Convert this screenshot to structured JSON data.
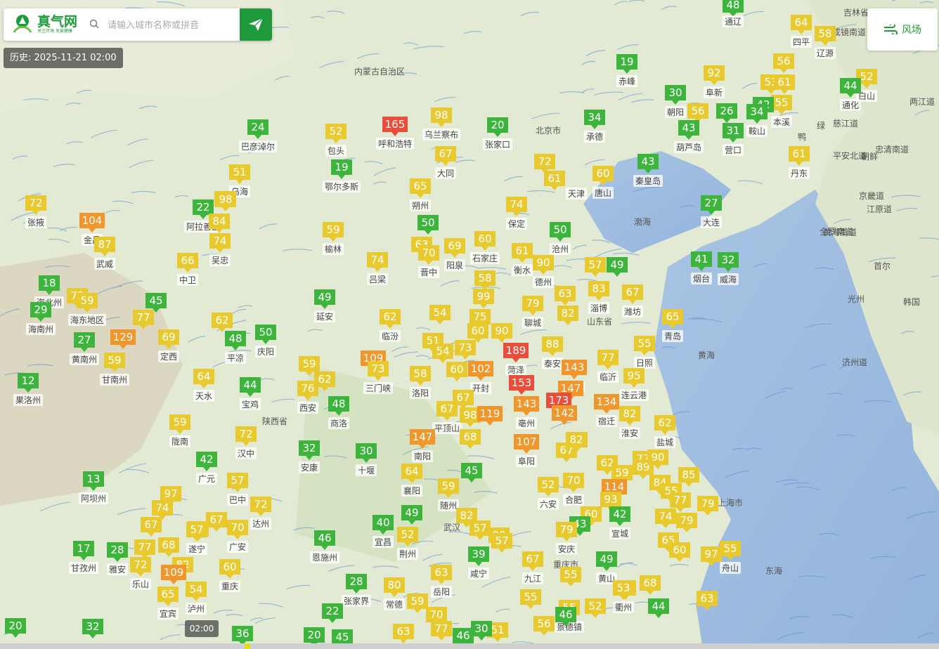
{
  "search": {
    "placeholder": "请输入城市名称或拼音"
  },
  "logo": {
    "title": "真气网",
    "slogan": "关注环境 关爱健康"
  },
  "history_label": "历史: 2025-11-21 02:00",
  "wind_button_label": "风场",
  "timeline_time": "02:00",
  "aqi_colors": {
    "good": "#3db53d",
    "moderate": "#e8c92e",
    "sensitive": "#f0962b",
    "unhealthy": "#e94e3c"
  },
  "places": [
    {
      "name": "",
      "aqi": 48
    },
    {
      "name": "通辽",
      "aqi": null
    },
    {
      "name": "四平",
      "aqi": 64
    },
    {
      "name": "辽源",
      "aqi": 58
    },
    {
      "name": "赤峰",
      "aqi": 19
    },
    {
      "name": "阜新",
      "aqi": 92
    },
    {
      "name": "",
      "aqi": 56
    },
    {
      "name": "",
      "aqi": 53
    },
    {
      "name": "",
      "aqi": 61
    },
    {
      "name": "本溪",
      "aqi": 55
    },
    {
      "name": "白山",
      "aqi": 52
    },
    {
      "name": "通化",
      "aqi": 44
    },
    {
      "name": "朝阳",
      "aqi": 30
    },
    {
      "name": "",
      "aqi": 56
    },
    {
      "name": "",
      "aqi": 26
    },
    {
      "name": "",
      "aqi": 42
    },
    {
      "name": "鞍山",
      "aqi": 34
    },
    {
      "name": "呼和浩特",
      "aqi": 165
    },
    {
      "name": "乌兰察布",
      "aqi": 98
    },
    {
      "name": "张家口",
      "aqi": 20
    },
    {
      "name": "承德",
      "aqi": 34
    },
    {
      "name": "葫芦岛",
      "aqi": 43
    },
    {
      "name": "营口",
      "aqi": 31
    },
    {
      "name": "巴彦淖尔",
      "aqi": 24
    },
    {
      "name": "包头",
      "aqi": 52
    },
    {
      "name": "鄂尔多斯",
      "aqi": 19
    },
    {
      "name": "大同",
      "aqi": 67
    },
    {
      "name": "",
      "aqi": 72
    },
    {
      "name": "",
      "aqi": 61
    },
    {
      "name": "唐山",
      "aqi": 60
    },
    {
      "name": "秦皇岛",
      "aqi": 43
    },
    {
      "name": "丹东",
      "aqi": 61
    },
    {
      "name": "乌海",
      "aqi": 51
    },
    {
      "name": "",
      "aqi": 64
    },
    {
      "name": "朔州",
      "aqi": 65
    },
    {
      "name": "天津",
      "aqi": null
    },
    {
      "name": "张掖",
      "aqi": 72
    },
    {
      "name": "阿拉善盟",
      "aqi": 22
    },
    {
      "name": "",
      "aqi": 98
    },
    {
      "name": "",
      "aqi": 84
    },
    {
      "name": "金昌",
      "aqi": 104
    },
    {
      "name": "武威",
      "aqi": 87
    },
    {
      "name": "保定",
      "aqi": 74
    },
    {
      "name": "大连",
      "aqi": 27
    },
    {
      "name": "榆林",
      "aqi": 59
    },
    {
      "name": "",
      "aqi": 50
    },
    {
      "name": "沧州",
      "aqi": 50
    },
    {
      "name": "吴忠",
      "aqi": 74
    },
    {
      "name": "中卫",
      "aqi": 66
    },
    {
      "name": "",
      "aqi": 63
    },
    {
      "name": "晋中",
      "aqi": 70
    },
    {
      "name": "阳泉",
      "aqi": 69
    },
    {
      "name": "石家庄",
      "aqi": 60
    },
    {
      "name": "衡水",
      "aqi": 61
    },
    {
      "name": "德州",
      "aqi": 90
    },
    {
      "name": "",
      "aqi": 57
    },
    {
      "name": "",
      "aqi": 49
    },
    {
      "name": "烟台",
      "aqi": 41
    },
    {
      "name": "威海",
      "aqi": 32
    },
    {
      "name": "吕梁",
      "aqi": 74
    },
    {
      "name": "",
      "aqi": 58
    },
    {
      "name": "",
      "aqi": 63
    },
    {
      "name": "淄博",
      "aqi": 83
    },
    {
      "name": "潍坊",
      "aqi": 67
    },
    {
      "name": "海北州",
      "aqi": 18
    },
    {
      "name": "",
      "aqi": 72
    },
    {
      "name": "海东地区",
      "aqi": 59
    },
    {
      "name": "",
      "aqi": 45
    },
    {
      "name": "延安",
      "aqi": 49
    },
    {
      "name": "",
      "aqi": 99
    },
    {
      "name": "聊城",
      "aqi": 79
    },
    {
      "name": "",
      "aqi": 82
    },
    {
      "name": "海南州",
      "aqi": 29
    },
    {
      "name": "",
      "aqi": 77
    },
    {
      "name": "",
      "aqi": 62
    },
    {
      "name": "临汾",
      "aqi": 62
    },
    {
      "name": "",
      "aqi": 54
    },
    {
      "name": "",
      "aqi": 75
    },
    {
      "name": "",
      "aqi": 60
    },
    {
      "name": "",
      "aqi": 90
    },
    {
      "name": "泰安",
      "aqi": 82
    },
    {
      "name": "青岛",
      "aqi": 65
    },
    {
      "name": "黄南州",
      "aqi": 27
    },
    {
      "name": "",
      "aqi": 129
    },
    {
      "name": "定西",
      "aqi": 69
    },
    {
      "name": "平凉",
      "aqi": 48
    },
    {
      "name": "庆阳",
      "aqi": 50
    },
    {
      "name": "",
      "aqi": 51
    },
    {
      "name": "",
      "aqi": 54
    },
    {
      "name": "",
      "aqi": 73
    },
    {
      "name": "菏泽",
      "aqi": 189
    },
    {
      "name": "",
      "aqi": 88
    },
    {
      "name": "日照",
      "aqi": 55
    },
    {
      "name": "甘南州",
      "aqi": 59
    },
    {
      "name": "",
      "aqi": 109
    },
    {
      "name": "三门峡",
      "aqi": 73
    },
    {
      "name": "",
      "aqi": 58
    },
    {
      "name": "",
      "aqi": 60
    },
    {
      "name": "开封",
      "aqi": 102
    },
    {
      "name": "济宁",
      "aqi": 143
    },
    {
      "name": "临沂",
      "aqi": 77
    },
    {
      "name": "果洛州",
      "aqi": 12
    },
    {
      "name": "天水",
      "aqi": 64
    },
    {
      "name": "宝鸡",
      "aqi": 44
    },
    {
      "name": "",
      "aqi": 59
    },
    {
      "name": "西安",
      "aqi": 76
    },
    {
      "name": "",
      "aqi": 62
    },
    {
      "name": "洛阳",
      "aqi": 58
    },
    {
      "name": "",
      "aqi": 153
    },
    {
      "name": "",
      "aqi": 147
    },
    {
      "name": "连云港",
      "aqi": 95
    },
    {
      "name": "商洛",
      "aqi": 48
    },
    {
      "name": "平顶山",
      "aqi": 67
    },
    {
      "name": "",
      "aqi": 67
    },
    {
      "name": "",
      "aqi": 98
    },
    {
      "name": "",
      "aqi": 119
    },
    {
      "name": "亳州",
      "aqi": 143
    },
    {
      "name": "",
      "aqi": 173
    },
    {
      "name": "",
      "aqi": 142
    },
    {
      "name": "宿迁",
      "aqi": 134
    },
    {
      "name": "陇南",
      "aqi": 59
    },
    {
      "name": "汉中",
      "aqi": 72
    },
    {
      "name": "",
      "aqi": 82
    },
    {
      "name": "盐城",
      "aqi": 62
    },
    {
      "name": "广元",
      "aqi": 42
    },
    {
      "name": "安康",
      "aqi": 32
    },
    {
      "name": "十堰",
      "aqi": 30
    },
    {
      "name": "南阳",
      "aqi": 147
    },
    {
      "name": "",
      "aqi": 68
    },
    {
      "name": "阜阳",
      "aqi": 107
    },
    {
      "name": "",
      "aqi": 67
    },
    {
      "name": "",
      "aqi": 82
    },
    {
      "name": "淮安",
      "aqi": 82
    },
    {
      "name": "阿坝州",
      "aqi": 13
    },
    {
      "name": "巴中",
      "aqi": 57
    },
    {
      "name": "襄阳",
      "aqi": 64
    },
    {
      "name": "",
      "aqi": 45
    },
    {
      "name": "",
      "aqi": 62
    },
    {
      "name": "",
      "aqi": 59
    },
    {
      "name": "",
      "aqi": 77
    },
    {
      "name": "",
      "aqi": 89
    },
    {
      "name": "",
      "aqi": 90
    },
    {
      "name": "",
      "aqi": 97
    },
    {
      "name": "",
      "aqi": 74
    },
    {
      "name": "达州",
      "aqi": 72
    },
    {
      "name": "随州",
      "aqi": 59
    },
    {
      "name": "六安",
      "aqi": 52
    },
    {
      "name": "合肥",
      "aqi": 70
    },
    {
      "name": "",
      "aqi": 114
    },
    {
      "name": "",
      "aqi": 84
    },
    {
      "name": "",
      "aqi": 55
    },
    {
      "name": "",
      "aqi": 85
    },
    {
      "name": "",
      "aqi": 67
    },
    {
      "name": "",
      "aqi": 57
    },
    {
      "name": "",
      "aqi": 67
    },
    {
      "name": "",
      "aqi": 70
    },
    {
      "name": "",
      "aqi": 49
    },
    {
      "name": "",
      "aqi": 82
    },
    {
      "name": "",
      "aqi": 57
    },
    {
      "name": "",
      "aqi": 93
    },
    {
      "name": "",
      "aqi": 60
    },
    {
      "name": "",
      "aqi": 43
    },
    {
      "name": "宣城",
      "aqi": 42
    },
    {
      "name": "",
      "aqi": 77
    },
    {
      "name": "",
      "aqi": 79
    },
    {
      "name": "",
      "aqi": 74
    },
    {
      "name": "",
      "aqi": 79
    },
    {
      "name": "甘孜州",
      "aqi": 17
    },
    {
      "name": "雅安",
      "aqi": 28
    },
    {
      "name": "",
      "aqi": 77
    },
    {
      "name": "",
      "aqi": 68
    },
    {
      "name": "遂宁",
      "aqi": 57
    },
    {
      "name": "广安",
      "aqi": 70
    },
    {
      "name": "恩施州",
      "aqi": 46
    },
    {
      "name": "宜昌",
      "aqi": 40
    },
    {
      "name": "荆州",
      "aqi": 52
    },
    {
      "name": "",
      "aqi": 90
    },
    {
      "name": "",
      "aqi": 57
    },
    {
      "name": "安庆",
      "aqi": 79
    },
    {
      "name": "",
      "aqi": 65
    },
    {
      "name": "",
      "aqi": 60
    },
    {
      "name": "",
      "aqi": 97
    },
    {
      "name": "舟山",
      "aqi": 55
    },
    {
      "name": "乐山",
      "aqi": 72
    },
    {
      "name": "",
      "aqi": 82
    },
    {
      "name": "重庆",
      "aqi": 60
    },
    {
      "name": "",
      "aqi": 109
    },
    {
      "name": "咸宁",
      "aqi": 39
    },
    {
      "name": "九江",
      "aqi": 67
    },
    {
      "name": "",
      "aqi": 55
    },
    {
      "name": "黄山",
      "aqi": 49
    },
    {
      "name": "",
      "aqi": 68
    },
    {
      "name": "",
      "aqi": 53
    },
    {
      "name": "宜宾",
      "aqi": 65
    },
    {
      "name": "泸州",
      "aqi": 54
    },
    {
      "name": "张家界",
      "aqi": 28
    },
    {
      "name": "常德",
      "aqi": 80
    },
    {
      "name": "岳阳",
      "aqi": 63
    },
    {
      "name": "",
      "aqi": 59
    },
    {
      "name": "",
      "aqi": 55
    },
    {
      "name": "景德镇",
      "aqi": 55
    },
    {
      "name": "",
      "aqi": 52
    },
    {
      "name": "衢州",
      "aqi": 53
    },
    {
      "name": "",
      "aqi": 44
    },
    {
      "name": "",
      "aqi": 63
    },
    {
      "name": "",
      "aqi": 20
    },
    {
      "name": "",
      "aqi": 32
    },
    {
      "name": "",
      "aqi": 36
    },
    {
      "name": "",
      "aqi": 22
    },
    {
      "name": "",
      "aqi": 70
    },
    {
      "name": "",
      "aqi": 77
    },
    {
      "name": "",
      "aqi": 63
    },
    {
      "name": "",
      "aqi": 46
    },
    {
      "name": "",
      "aqi": 56
    },
    {
      "name": "",
      "aqi": 51
    },
    {
      "name": "",
      "aqi": 20
    },
    {
      "name": "",
      "aqi": 45
    },
    {
      "name": "",
      "aqi": 30
    },
    {
      "name": "",
      "aqi": 46
    }
  ],
  "map_labels": [
    "内蒙古自治区",
    "北京市",
    "吉林省",
    "陕西省",
    "山东省",
    "重庆市",
    "武汉",
    "渤海",
    "黄海",
    "东海",
    "朝鲜",
    "韩国",
    "首尔",
    "京畿道",
    "江原道",
    "平安北道",
    "两江道",
    "忠清南道",
    "全罗南道",
    "光州",
    "济州道",
    "成镜南道",
    "慈江道",
    "黄海南道",
    "上海市",
    "鸭",
    "绿"
  ]
}
